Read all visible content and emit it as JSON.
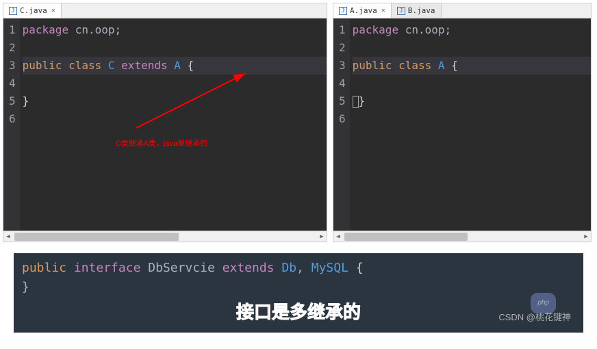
{
  "left_editor": {
    "tabs": [
      {
        "label": "C.java",
        "active": true
      }
    ],
    "lines": [
      {
        "num": "1",
        "segments": [
          {
            "cls": "kw-package",
            "t": "package"
          },
          {
            "cls": "identifier",
            "t": " cn.oop"
          },
          {
            "cls": "punct",
            "t": ";"
          }
        ]
      },
      {
        "num": "2",
        "segments": []
      },
      {
        "num": "3",
        "highlight": true,
        "segments": [
          {
            "cls": "kw-public",
            "t": "public"
          },
          {
            "cls": "",
            "t": " "
          },
          {
            "cls": "kw-class",
            "t": "class"
          },
          {
            "cls": "",
            "t": " "
          },
          {
            "cls": "type",
            "t": "C"
          },
          {
            "cls": "",
            "t": " "
          },
          {
            "cls": "kw-extends",
            "t": "extends"
          },
          {
            "cls": "",
            "t": " "
          },
          {
            "cls": "type",
            "t": "A"
          },
          {
            "cls": "",
            "t": " "
          },
          {
            "cls": "brace",
            "t": "{"
          }
        ]
      },
      {
        "num": "4",
        "segments": []
      },
      {
        "num": "5",
        "segments": [
          {
            "cls": "brace",
            "t": "}"
          }
        ]
      },
      {
        "num": "6",
        "segments": []
      }
    ],
    "annotation": "C类继承A类，java单继承的"
  },
  "right_editor": {
    "tabs": [
      {
        "label": "A.java",
        "active": true
      },
      {
        "label": "B.java",
        "active": false
      }
    ],
    "lines": [
      {
        "num": "1",
        "segments": [
          {
            "cls": "kw-package",
            "t": "package"
          },
          {
            "cls": "identifier",
            "t": " cn.oop"
          },
          {
            "cls": "punct",
            "t": ";"
          }
        ]
      },
      {
        "num": "2",
        "segments": []
      },
      {
        "num": "3",
        "highlight": true,
        "segments": [
          {
            "cls": "kw-public",
            "t": "public"
          },
          {
            "cls": "",
            "t": " "
          },
          {
            "cls": "kw-class",
            "t": "class"
          },
          {
            "cls": "",
            "t": " "
          },
          {
            "cls": "type",
            "t": "A"
          },
          {
            "cls": "",
            "t": " "
          },
          {
            "cls": "brace",
            "t": "{"
          }
        ]
      },
      {
        "num": "4",
        "segments": []
      },
      {
        "num": "5",
        "cursor": true,
        "segments": [
          {
            "cls": "brace",
            "t": "}"
          }
        ]
      },
      {
        "num": "6",
        "segments": []
      }
    ]
  },
  "bottom": {
    "segments": [
      {
        "cls": "kw-public",
        "t": "public"
      },
      {
        "cls": "",
        "t": " "
      },
      {
        "cls": "kw-interface",
        "t": "interface"
      },
      {
        "cls": "",
        "t": " "
      },
      {
        "cls": "identifier",
        "t": "DbServcie"
      },
      {
        "cls": "",
        "t": " "
      },
      {
        "cls": "kw-extends",
        "t": "extends"
      },
      {
        "cls": "",
        "t": " "
      },
      {
        "cls": "type",
        "t": "Db"
      },
      {
        "cls": "punct",
        "t": ", "
      },
      {
        "cls": "type",
        "t": "MySQL"
      },
      {
        "cls": "",
        "t": " "
      },
      {
        "cls": "brace",
        "t": "{"
      }
    ],
    "line2": "}",
    "caption": "接口是多继承的"
  },
  "watermark": "CSDN @桃花键神",
  "php_badge": "php"
}
